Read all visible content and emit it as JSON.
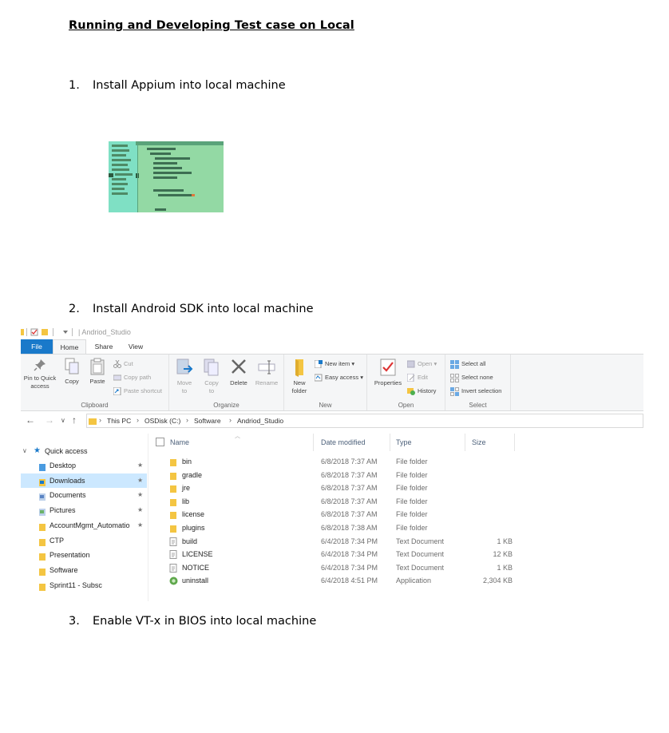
{
  "document": {
    "heading": "Running and Developing Test case on Local",
    "steps": [
      {
        "number": "1.",
        "text": "Install Appium into local machine"
      },
      {
        "number": "2.",
        "text": "Install Android SDK into local machine"
      },
      {
        "number": "3.",
        "text": "Enable VT-x in BIOS into local machine"
      }
    ]
  },
  "explorer": {
    "title": "| Andriod_Studio",
    "tabs": {
      "file": "File",
      "home": "Home",
      "share": "Share",
      "view": "View"
    },
    "ribbon": {
      "clipboard": {
        "label": "Clipboard",
        "pin_to_quick_access": "Pin to Quick access",
        "copy": "Copy",
        "paste": "Paste",
        "cut": "Cut",
        "copy_path": "Copy path",
        "paste_shortcut": "Paste shortcut"
      },
      "organize": {
        "label": "Organize",
        "move_to": "Move to",
        "copy_to": "Copy to",
        "delete": "Delete",
        "rename": "Rename"
      },
      "new": {
        "label": "New",
        "new_folder": "New folder",
        "new_item": "New item",
        "easy_access": "Easy access"
      },
      "open": {
        "label": "Open",
        "properties": "Properties",
        "open": "Open",
        "edit": "Edit",
        "history": "History"
      },
      "select": {
        "label": "Select",
        "select_all": "Select all",
        "select_none": "Select none",
        "invert_selection": "Invert selection"
      }
    },
    "breadcrumb": [
      "This PC",
      "OSDisk (C:)",
      "Software",
      "Andriod_Studio"
    ],
    "nav": {
      "quick_access": "Quick access",
      "items": [
        {
          "label": "Desktop",
          "pinned": true,
          "icon": "desktop-folder-icon"
        },
        {
          "label": "Downloads",
          "pinned": true,
          "icon": "downloads-folder-icon",
          "selected": true
        },
        {
          "label": "Documents",
          "pinned": true,
          "icon": "documents-folder-icon"
        },
        {
          "label": "Pictures",
          "pinned": true,
          "icon": "pictures-folder-icon"
        },
        {
          "label": "AccountMgmt_Automatio",
          "pinned": true,
          "icon": "folder-icon"
        },
        {
          "label": "CTP",
          "pinned": false,
          "icon": "folder-icon"
        },
        {
          "label": "Presentation",
          "pinned": false,
          "icon": "folder-icon"
        },
        {
          "label": "Software",
          "pinned": false,
          "icon": "folder-icon"
        },
        {
          "label": "Sprint11 - Subsc",
          "pinned": false,
          "icon": "folder-icon"
        }
      ],
      "pin_glyph": "★"
    },
    "columns": {
      "name": "Name",
      "date": "Date modified",
      "type": "Type",
      "size": "Size"
    },
    "files": [
      {
        "name": "bin",
        "date": "6/8/2018 7:37 AM",
        "type": "File folder",
        "size": "",
        "icon": "folder-icon"
      },
      {
        "name": "gradle",
        "date": "6/8/2018 7:37 AM",
        "type": "File folder",
        "size": "",
        "icon": "folder-icon"
      },
      {
        "name": "jre",
        "date": "6/8/2018 7:37 AM",
        "type": "File folder",
        "size": "",
        "icon": "folder-icon"
      },
      {
        "name": "lib",
        "date": "6/8/2018 7:37 AM",
        "type": "File folder",
        "size": "",
        "icon": "folder-icon"
      },
      {
        "name": "license",
        "date": "6/8/2018 7:37 AM",
        "type": "File folder",
        "size": "",
        "icon": "folder-icon"
      },
      {
        "name": "plugins",
        "date": "6/8/2018 7:38 AM",
        "type": "File folder",
        "size": "",
        "icon": "folder-icon"
      },
      {
        "name": "build",
        "date": "6/4/2018 7:34 PM",
        "type": "Text Document",
        "size": "1 KB",
        "icon": "text-document-icon"
      },
      {
        "name": "LICENSE",
        "date": "6/4/2018 7:34 PM",
        "type": "Text Document",
        "size": "12 KB",
        "icon": "text-document-icon"
      },
      {
        "name": "NOTICE",
        "date": "6/4/2018 7:34 PM",
        "type": "Text Document",
        "size": "1 KB",
        "icon": "text-document-icon"
      },
      {
        "name": "uninstall",
        "date": "6/4/2018 4:51 PM",
        "type": "Application",
        "size": "2,304 KB",
        "icon": "application-icon"
      }
    ],
    "colors": {
      "file_tab": "#1979ca",
      "folder": "#f4c542",
      "selection": "#cce8ff"
    }
  }
}
